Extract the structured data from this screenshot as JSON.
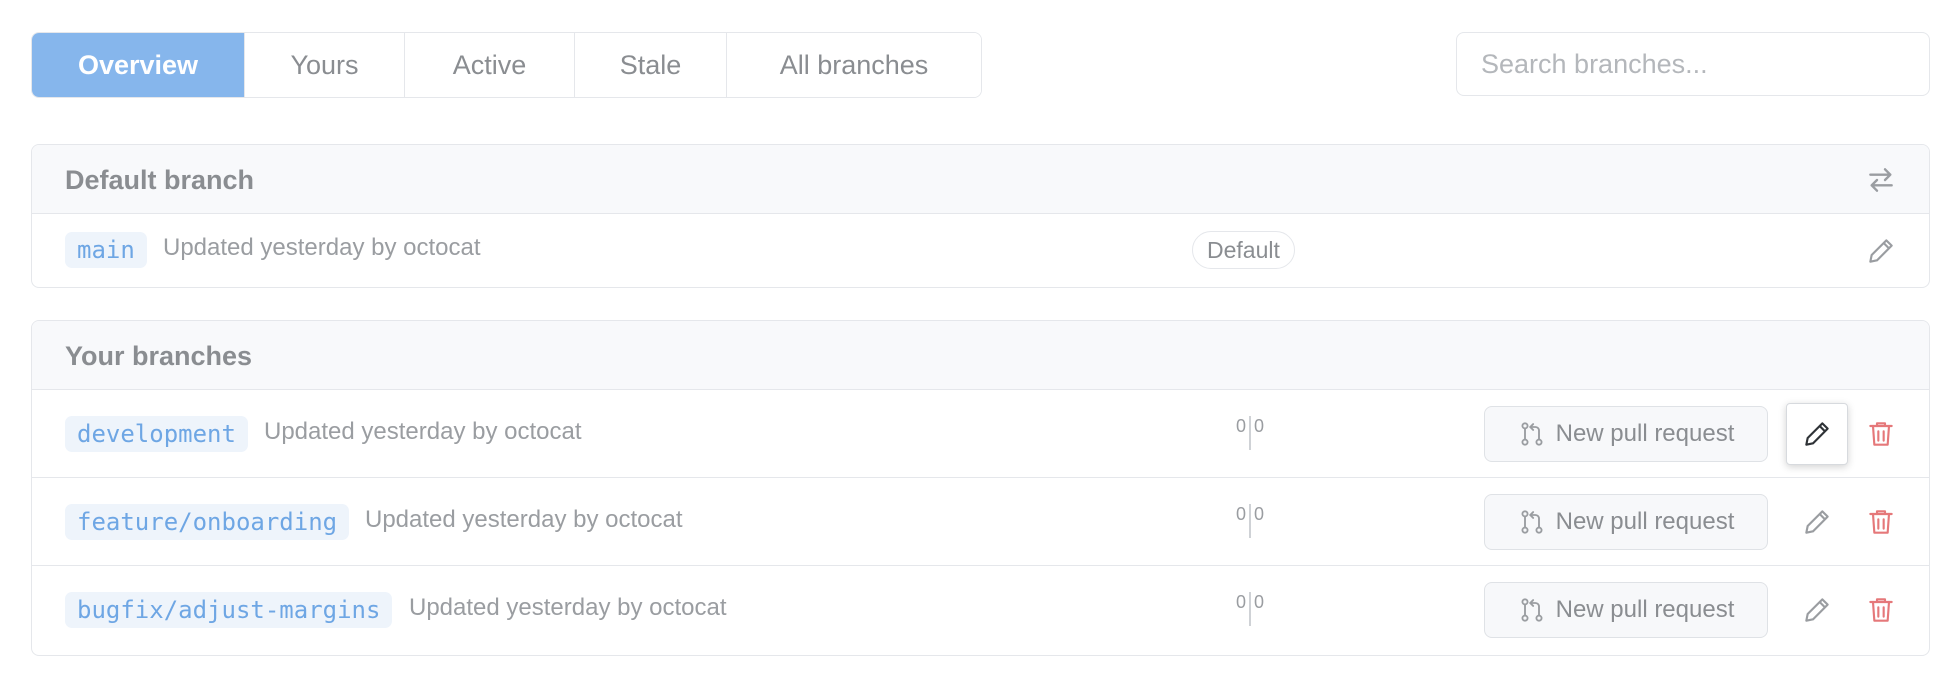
{
  "tabs": [
    {
      "label": "Overview",
      "active": true
    },
    {
      "label": "Yours"
    },
    {
      "label": "Active"
    },
    {
      "label": "Stale"
    },
    {
      "label": "All branches"
    }
  ],
  "search": {
    "placeholder": "Search branches..."
  },
  "default_section": {
    "title": "Default branch",
    "branch": {
      "name": "main",
      "meta": "Updated yesterday by octocat",
      "badge": "Default"
    }
  },
  "your_section": {
    "title": "Your branches",
    "branches": [
      {
        "name": "development",
        "meta": "Updated yesterday by octocat",
        "behind": "0",
        "ahead": "0",
        "pr_label": "New pull request"
      },
      {
        "name": "feature/onboarding",
        "meta": "Updated yesterday by octocat",
        "behind": "0",
        "ahead": "0",
        "pr_label": "New pull request"
      },
      {
        "name": "bugfix/adjust-margins",
        "meta": "Updated yesterday by octocat",
        "behind": "0",
        "ahead": "0",
        "pr_label": "New pull request"
      }
    ]
  },
  "colors": {
    "accent": "#86b6ec",
    "branch_text": "#6ea6e4",
    "branch_bg": "#eef4fb",
    "delete": "#e5787a"
  },
  "icons": {
    "switch": "arrow-switch-icon",
    "edit": "pencil-icon",
    "delete": "trash-icon",
    "pull_request": "git-pull-request-icon"
  }
}
